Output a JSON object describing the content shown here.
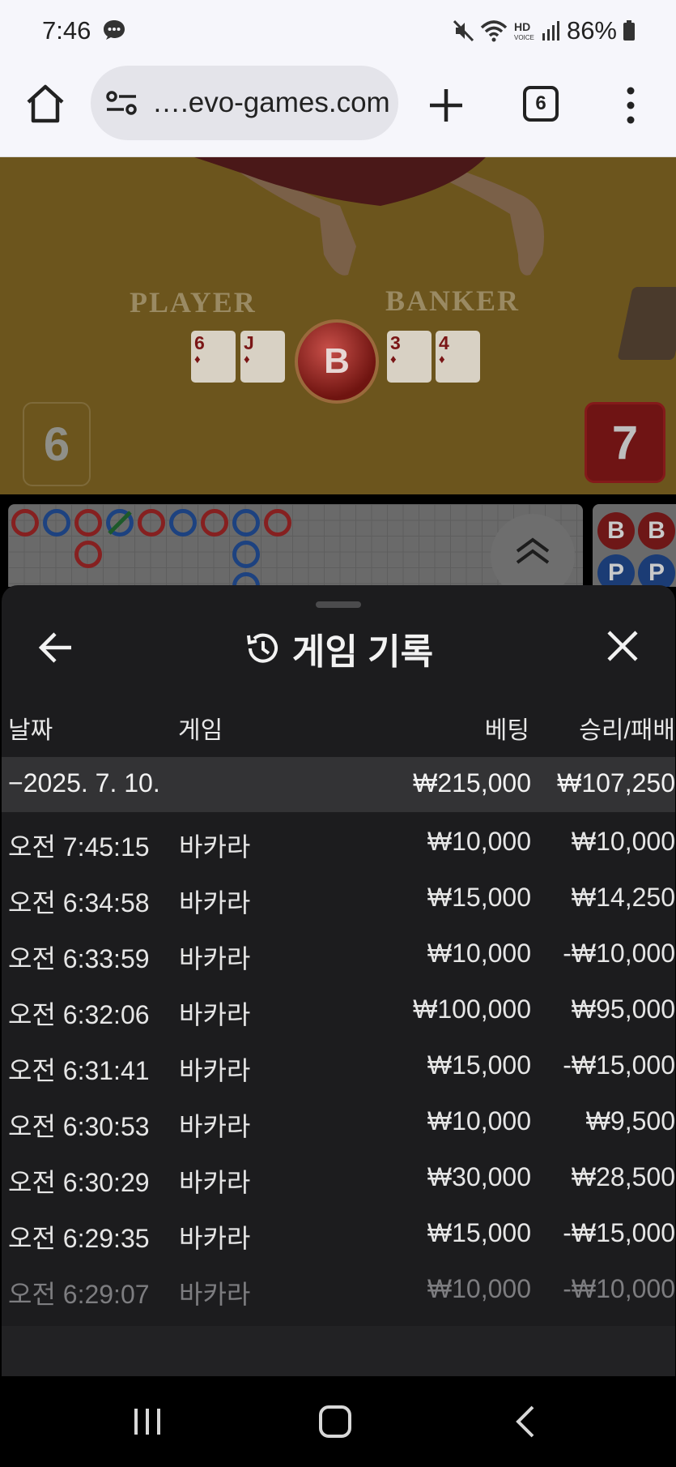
{
  "status_bar": {
    "time": "7:46",
    "battery": "86%",
    "icons": [
      "chat-bubble-icon",
      "mute-icon",
      "wifi-icon",
      "hd-voice-icon",
      "signal-icon",
      "battery-icon"
    ]
  },
  "browser": {
    "url": "….evo-games.com",
    "tab_count": "6",
    "icons": [
      "home-icon",
      "site-settings-icon",
      "plus-icon",
      "tabs-icon",
      "more-vert-icon"
    ]
  },
  "game": {
    "player_label": "PLAYER",
    "banker_label": "BANKER",
    "player_cards": [
      {
        "rank": "6",
        "suit": "♦"
      },
      {
        "rank": "J",
        "suit": "♦"
      }
    ],
    "banker_cards": [
      {
        "rank": "3",
        "suit": "♦"
      },
      {
        "rank": "4",
        "suit": "♦"
      }
    ],
    "result": "B",
    "player_score": "6",
    "banker_score": "7",
    "side_road": [
      "B",
      "B",
      "P",
      "P"
    ]
  },
  "history": {
    "title": "게임 기록",
    "columns": {
      "date": "날짜",
      "game": "게임",
      "bet": "베팅",
      "result": "승리/패배"
    },
    "date_group": {
      "label": "−2025. 7. 10.",
      "bet_total": "₩215,000",
      "result_total": "₩107,250"
    },
    "rows": [
      {
        "time": "오전 7:45:15",
        "game": "바카라",
        "bet": "₩10,000",
        "result": "₩10,000"
      },
      {
        "time": "오전 6:34:58",
        "game": "바카라",
        "bet": "₩15,000",
        "result": "₩14,250"
      },
      {
        "time": "오전 6:33:59",
        "game": "바카라",
        "bet": "₩10,000",
        "result": "-₩10,000"
      },
      {
        "time": "오전 6:32:06",
        "game": "바카라",
        "bet": "₩100,000",
        "result": "₩95,000"
      },
      {
        "time": "오전 6:31:41",
        "game": "바카라",
        "bet": "₩15,000",
        "result": "-₩15,000"
      },
      {
        "time": "오전 6:30:53",
        "game": "바카라",
        "bet": "₩10,000",
        "result": "₩9,500"
      },
      {
        "time": "오전 6:30:29",
        "game": "바카라",
        "bet": "₩30,000",
        "result": "₩28,500"
      },
      {
        "time": "오전 6:29:35",
        "game": "바카라",
        "bet": "₩15,000",
        "result": "-₩15,000"
      },
      {
        "time": "오전 6:29:07",
        "game": "바카라",
        "bet": "₩10,000",
        "result": "-₩10,000"
      }
    ]
  },
  "colors": {
    "sheet_bg": "#1c1c1e",
    "date_row_bg": "#333335",
    "banker_red": "#862020",
    "player_blue": "#1d4280"
  }
}
